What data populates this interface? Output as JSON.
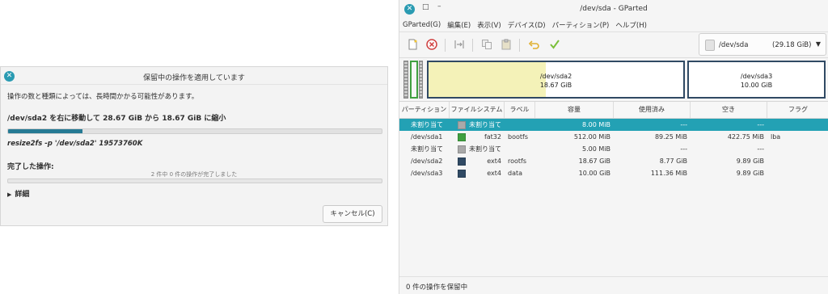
{
  "dialog": {
    "title": "保留中の操作を適用しています",
    "description": "操作の数と種類によっては、長時間かかる可能性があります。",
    "current_operation": "/dev/sda2 を右に移動して 28.67 GiB から 18.67 GiB に縮小",
    "progress": 0.2,
    "command": "resize2fs -p '/dev/sda2' 19573760K",
    "completed_heading": "完了した操作:",
    "completed_status": "2 件中 0 件の操作が完了しました",
    "details_label": "詳細",
    "cancel_label": "キャンセル(C)"
  },
  "gparted": {
    "window_title": "/dev/sda - GParted",
    "menu": [
      "GParted(G)",
      "編集(E)",
      "表示(V)",
      "デバイス(D)",
      "パーティション(P)",
      "ヘルプ(H)"
    ],
    "device": {
      "name": "/dev/sda",
      "size": "(29.18 GiB)"
    },
    "map": {
      "sda2": {
        "name": "/dev/sda2",
        "size": "18.67 GiB"
      },
      "sda3": {
        "name": "/dev/sda3",
        "size": "10.00 GiB"
      }
    },
    "columns": [
      "パーティション",
      "ファイルシステム",
      "ラベル",
      "容量",
      "使用済み",
      "空き",
      "フラグ"
    ],
    "rows": [
      {
        "partition": "未割り当て",
        "fs": "未割り当て",
        "fs_color": "#a9a9a9",
        "label": "",
        "size": "8.00 MiB",
        "used": "---",
        "free": "---",
        "flags": ""
      },
      {
        "partition": "/dev/sda1",
        "fs": "fat32",
        "fs_color": "#40a040",
        "label": "bootfs",
        "size": "512.00 MiB",
        "used": "89.25 MiB",
        "free": "422.75 MiB",
        "flags": "lba"
      },
      {
        "partition": "未割り当て",
        "fs": "未割り当て",
        "fs_color": "#a9a9a9",
        "label": "",
        "size": "5.00 MiB",
        "used": "---",
        "free": "---",
        "flags": ""
      },
      {
        "partition": "/dev/sda2",
        "fs": "ext4",
        "fs_color": "#304a64",
        "label": "rootfs",
        "size": "18.67 GiB",
        "used": "8.77 GiB",
        "free": "9.89 GiB",
        "flags": ""
      },
      {
        "partition": "/dev/sda3",
        "fs": "ext4",
        "fs_color": "#304a64",
        "label": "data",
        "size": "10.00 GiB",
        "used": "111.36 MiB",
        "free": "9.89 GiB",
        "flags": ""
      }
    ],
    "status": "0 件の操作を保留中"
  },
  "colors": {
    "accent": "#23a1b4",
    "progress": "#267a94",
    "unused": "#f4f2b8",
    "ext4": "#304a64",
    "fat32": "#40a040"
  },
  "icons": [
    "new-icon",
    "delete-icon",
    "resize-icon",
    "copy-icon",
    "paste-icon",
    "undo-icon",
    "apply-icon",
    "disk-icon"
  ]
}
